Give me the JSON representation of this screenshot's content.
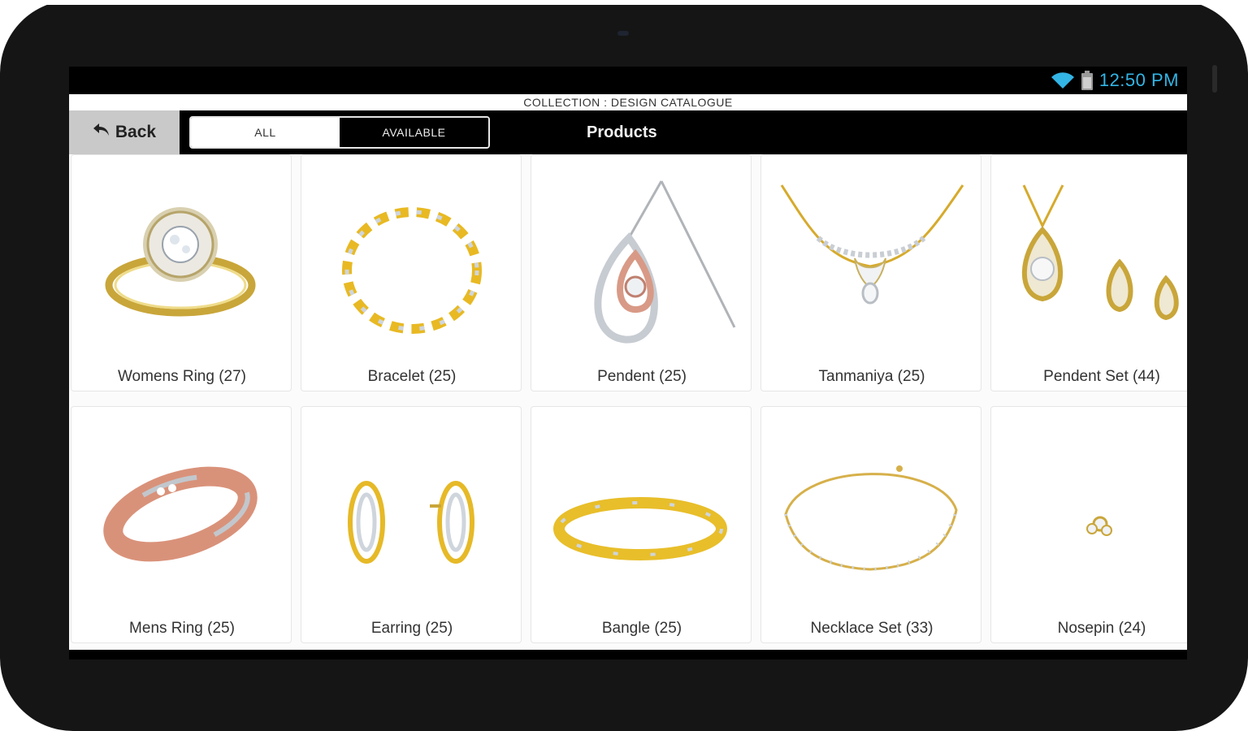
{
  "status": {
    "time": "12:50 PM",
    "wifi_icon": "wifi-icon",
    "battery_icon": "battery-icon",
    "accent": "#33b5e5"
  },
  "header": {
    "collection_title": "COLLECTION : DESIGN CATALOGUE"
  },
  "toolbar": {
    "back_label": "Back",
    "back_icon": "back-arrow-icon",
    "filter_all": "ALL",
    "filter_available": "AVAILABLE",
    "selected_filter": "ALL",
    "title": "Products"
  },
  "products": [
    {
      "label": "Womens Ring (27)",
      "icon": "womens-ring-image"
    },
    {
      "label": "Bracelet (25)",
      "icon": "bracelet-image"
    },
    {
      "label": "Pendent (25)",
      "icon": "pendent-image"
    },
    {
      "label": "Tanmaniya (25)",
      "icon": "tanmaniya-image"
    },
    {
      "label": "Pendent Set (44)",
      "icon": "pendent-set-image"
    },
    {
      "label": "Mens Ring (25)",
      "icon": "mens-ring-image"
    },
    {
      "label": "Earring (25)",
      "icon": "earring-image"
    },
    {
      "label": "Bangle (25)",
      "icon": "bangle-image"
    },
    {
      "label": "Necklace Set (33)",
      "icon": "necklace-set-image"
    },
    {
      "label": "Nosepin (24)",
      "icon": "nosepin-image"
    }
  ]
}
